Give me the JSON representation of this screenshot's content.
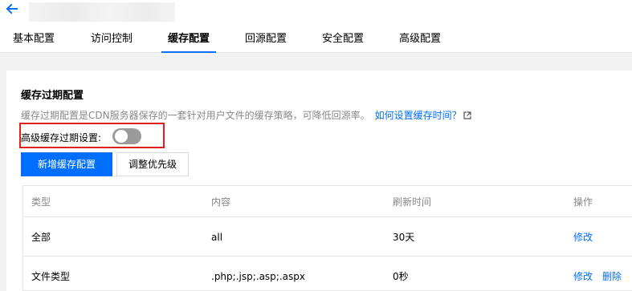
{
  "header": {
    "tabs": [
      {
        "label": "基本配置"
      },
      {
        "label": "访问控制"
      },
      {
        "label": "缓存配置",
        "active": true
      },
      {
        "label": "回源配置"
      },
      {
        "label": "安全配置"
      },
      {
        "label": "高级配置"
      }
    ]
  },
  "cache": {
    "title": "缓存过期配置",
    "description": "缓存过期配置是CDN服务器保存的一套针对用户文件的缓存策略，可降低回源率。",
    "help_link": "如何设置缓存时间？",
    "advanced_toggle_label": "高级缓存过期设置:",
    "advanced_toggle_on": false,
    "add_button": "新增缓存配置",
    "priority_button": "调整优先级"
  },
  "table": {
    "columns": [
      "类型",
      "内容",
      "刷新时间",
      "操作"
    ],
    "rows": [
      {
        "type": "全部",
        "content": "all",
        "refresh": "30天",
        "actions": [
          "修改"
        ]
      },
      {
        "type": "文件类型",
        "content": ".php;.jsp;.asp;.aspx",
        "refresh": "0秒",
        "actions": [
          "修改",
          "删除"
        ]
      }
    ]
  },
  "colors": {
    "accent": "#006eff",
    "highlight": "#e02020",
    "toggle_off": "#9a9a9a"
  },
  "icons": [
    "back-arrow-icon",
    "external-link-icon"
  ]
}
